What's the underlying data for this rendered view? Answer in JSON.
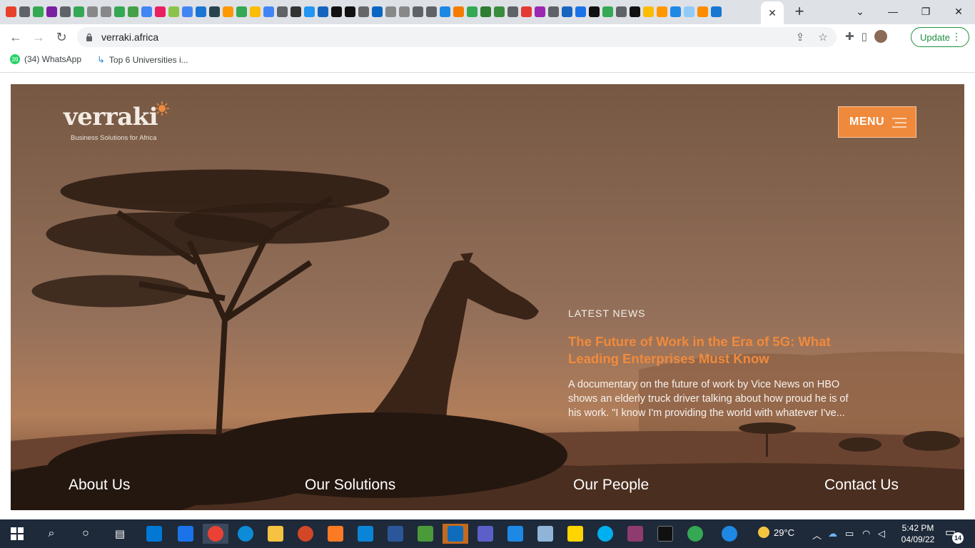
{
  "browser": {
    "tab_close": "✕",
    "new_tab": "+",
    "url": "verraki.africa",
    "update_label": "Update",
    "bookmarks": [
      {
        "badge": "39",
        "label": "(34) WhatsApp"
      },
      {
        "label": "Top 6 Universities i..."
      }
    ]
  },
  "site": {
    "logo_word": "verraki",
    "logo_tagline": "Business Solutions for Africa",
    "menu_label": "MENU",
    "news": {
      "label": "LATEST NEWS",
      "title": "The Future of Work in the Era of 5G: What Leading Enterprises Must Know",
      "body": "A documentary on the future of work by Vice News on HBO shows an elderly truck driver talking about how proud he is of his work. \"I know I'm providing the world with whatever I've..."
    },
    "footer_links": [
      "About Us",
      "Our Solutions",
      "Our People",
      "Contact Us"
    ],
    "colors": {
      "accent": "#ef8a3c",
      "title": "#f08a3c"
    }
  },
  "taskbar": {
    "temperature": "29°C",
    "time": "5:42 PM",
    "date": "04/09/22",
    "notification_count": "14"
  }
}
